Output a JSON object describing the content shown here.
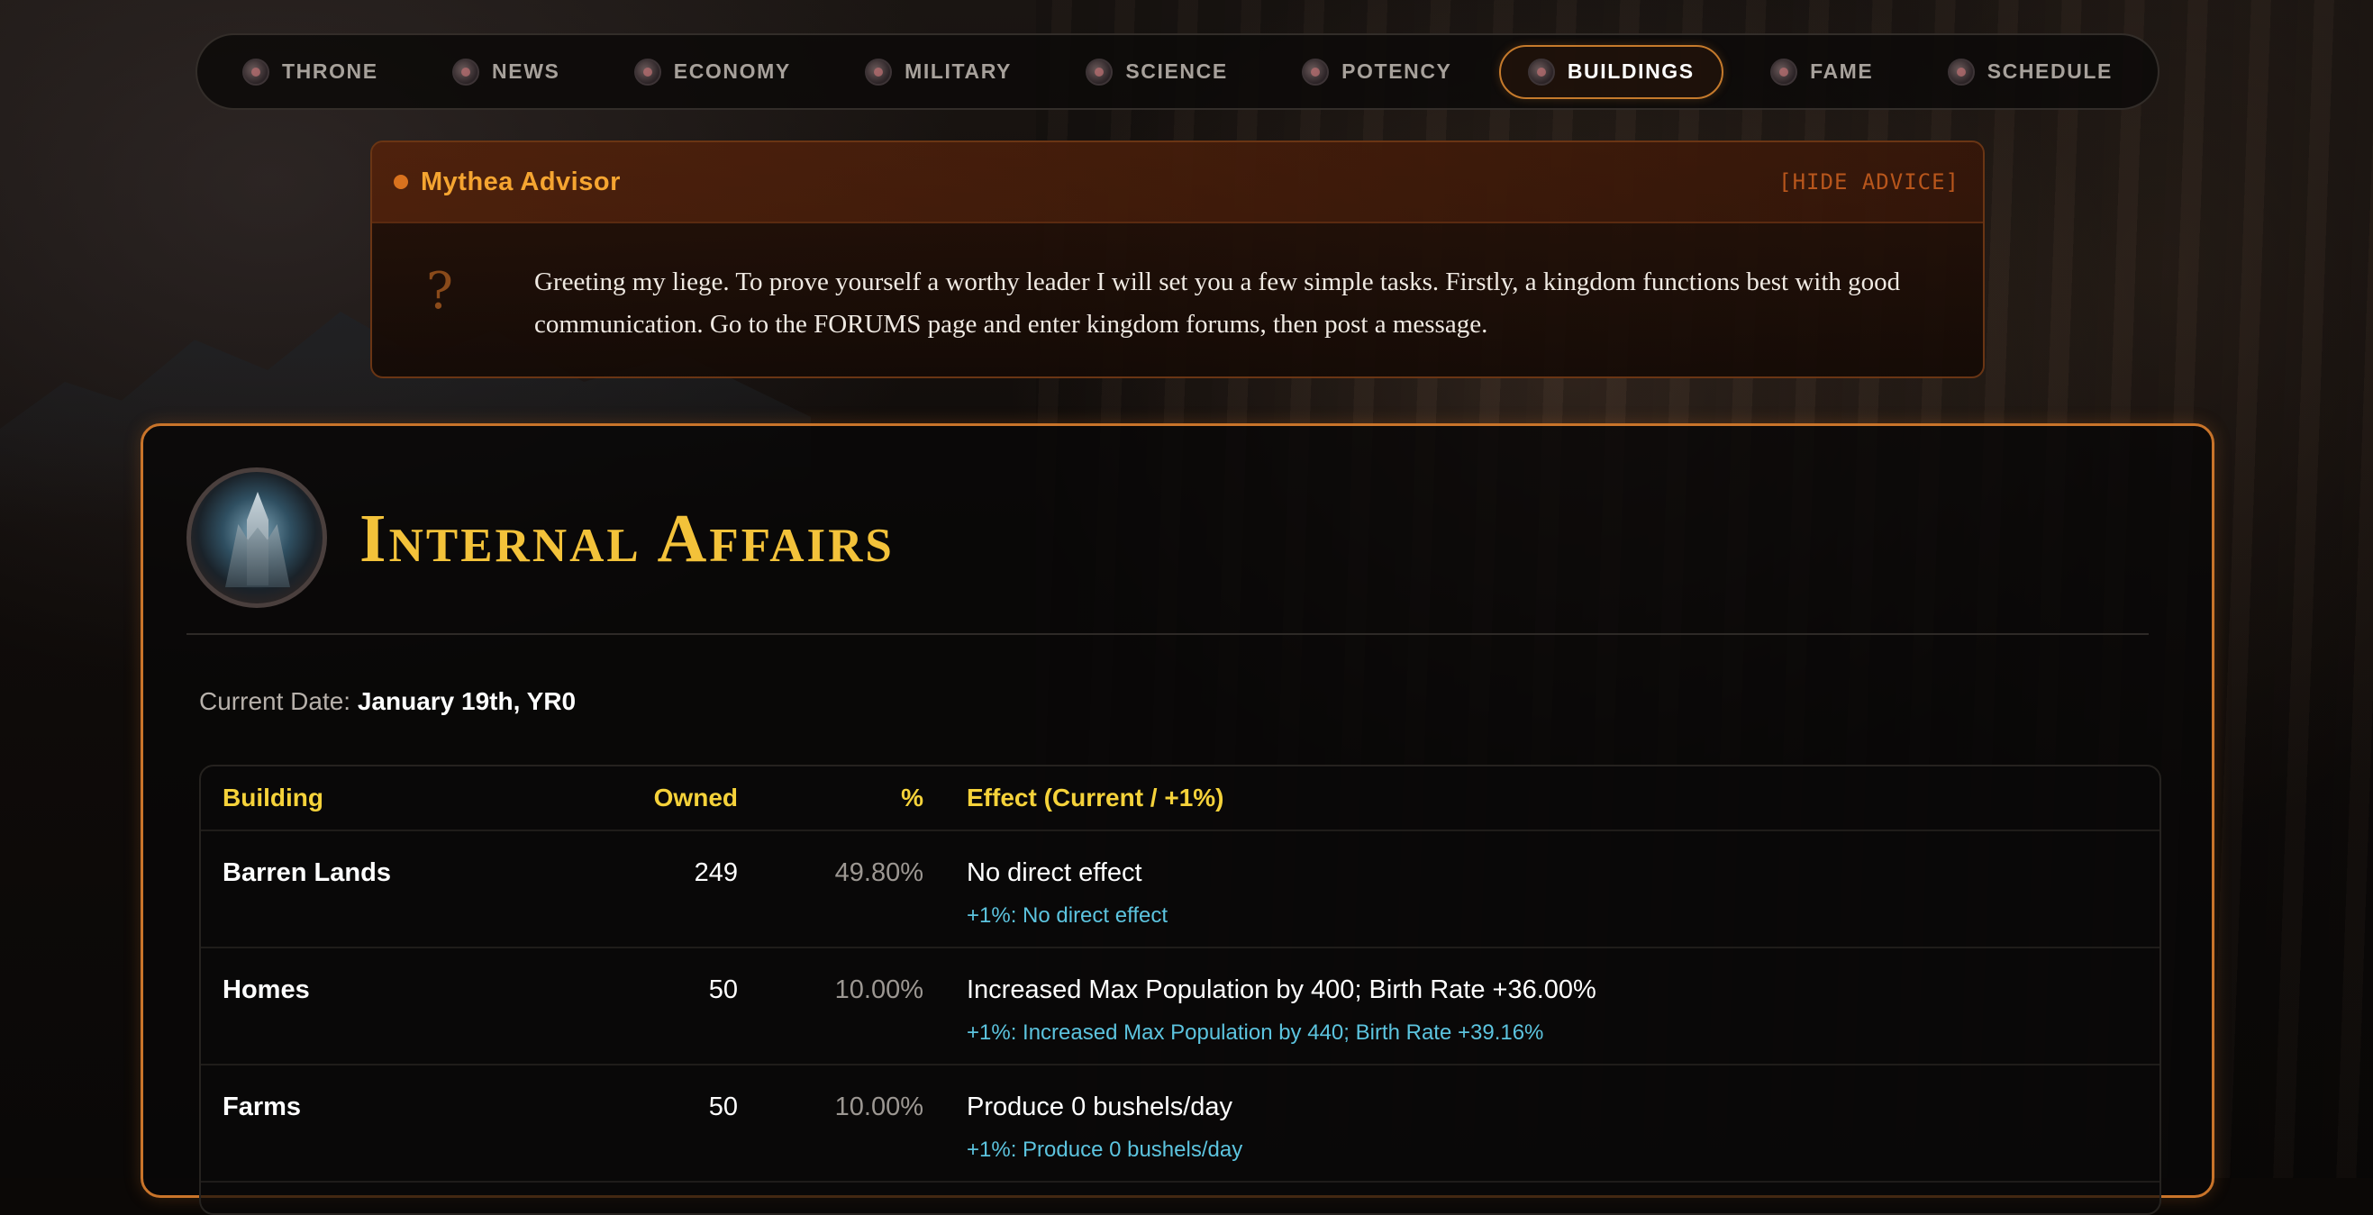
{
  "nav": {
    "items": [
      {
        "label": "THRONE",
        "icon": "throne-icon"
      },
      {
        "label": "NEWS",
        "icon": "news-icon"
      },
      {
        "label": "ECONOMY",
        "icon": "economy-icon"
      },
      {
        "label": "MILITARY",
        "icon": "military-icon"
      },
      {
        "label": "SCIENCE",
        "icon": "science-icon"
      },
      {
        "label": "POTENCY",
        "icon": "potency-icon"
      },
      {
        "label": "BUILDINGS",
        "icon": "buildings-icon",
        "active": true
      },
      {
        "label": "FAME",
        "icon": "fame-icon"
      },
      {
        "label": "SCHEDULE",
        "icon": "schedule-icon"
      }
    ]
  },
  "advisor": {
    "name": "Mythea Advisor",
    "hide_label": "[HIDE ADVICE]",
    "icon": "?",
    "message": "Greeting my liege. To prove yourself a worthy leader I will set you a few simple tasks. Firstly, a kingdom functions best with good communication. Go to the FORUMS page and enter kingdom forums, then post a message."
  },
  "panel": {
    "title": "Internal Affairs",
    "emblem_icon": "tower-emblem-icon",
    "date_label": "Current Date:",
    "date_value": "January 19th, YR0"
  },
  "table": {
    "headers": {
      "building": "Building",
      "owned": "Owned",
      "percent": "%",
      "effect": "Effect (Current / +1%)"
    },
    "rows": [
      {
        "building": "Barren Lands",
        "owned": "249",
        "percent": "49.80%",
        "effect": "No direct effect",
        "plus": "+1%: No direct effect"
      },
      {
        "building": "Homes",
        "owned": "50",
        "percent": "10.00%",
        "effect": "Increased Max Population by 400; Birth Rate +36.00%",
        "plus": "+1%: Increased Max Population by 440; Birth Rate +39.16%"
      },
      {
        "building": "Farms",
        "owned": "50",
        "percent": "10.00%",
        "effect": "Produce 0 bushels/day",
        "plus": "+1%: Produce 0 bushels/day"
      }
    ]
  },
  "colors": {
    "accent_orange": "#c9742a",
    "title_gold": "#f3c23a",
    "header_yellow": "#f5d23a",
    "advisor_orange": "#f5a531",
    "effect_cyan": "#5cc4df"
  }
}
